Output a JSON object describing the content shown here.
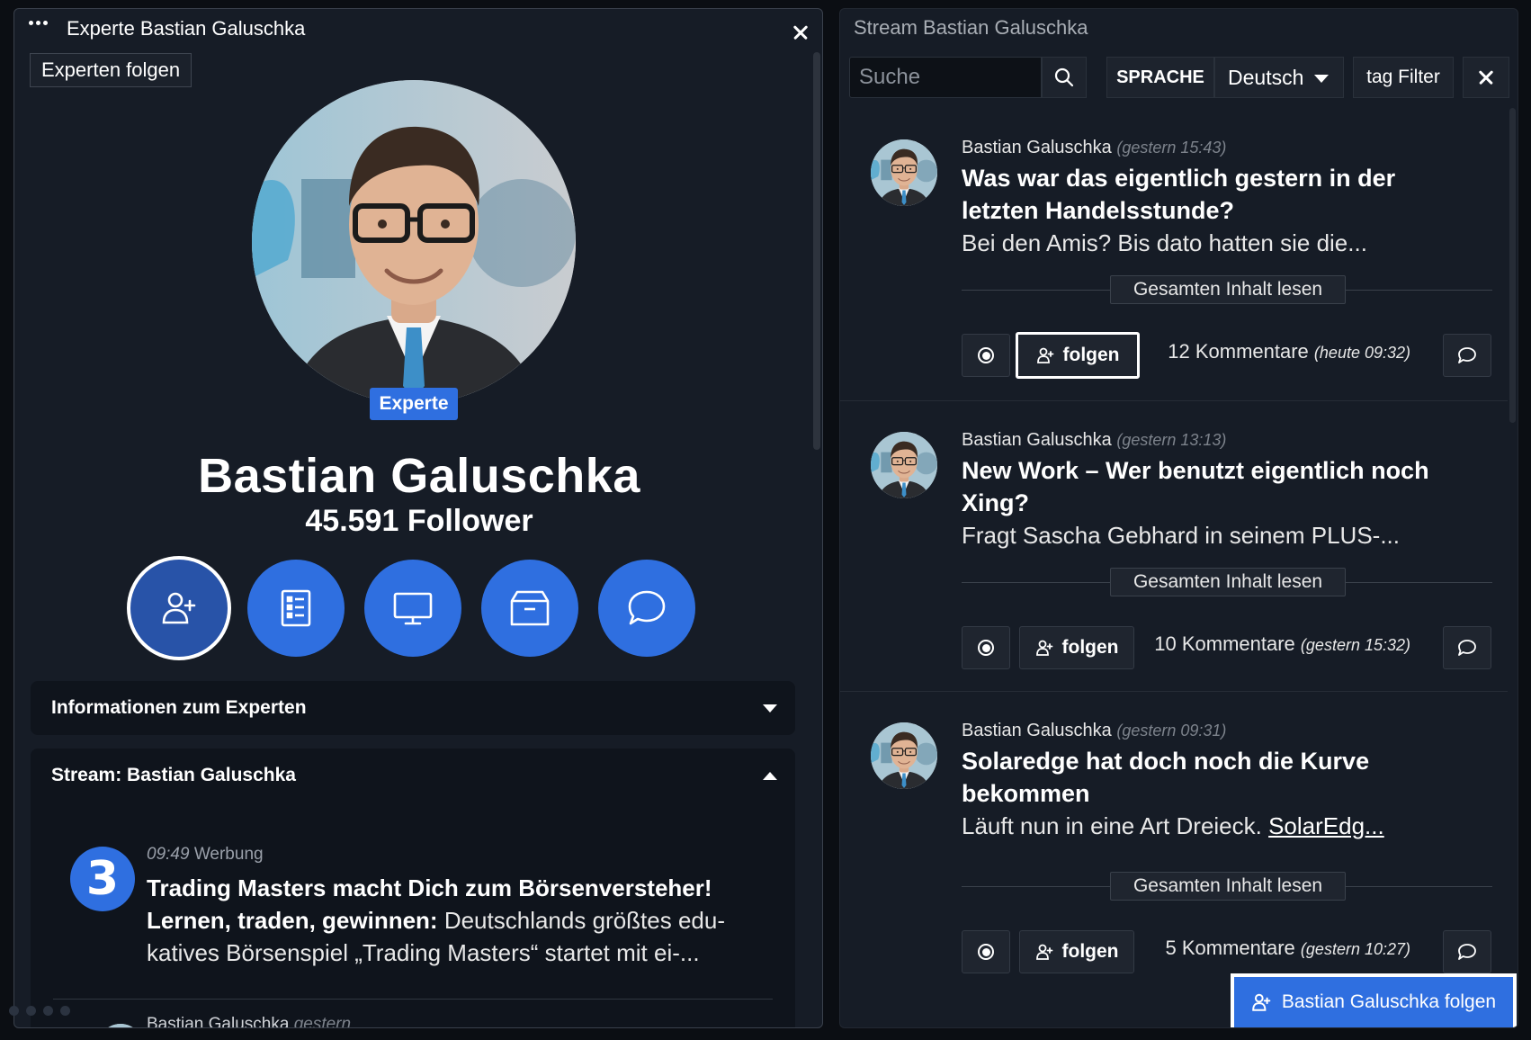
{
  "left_panel": {
    "header_title": "Experte Bastian Galuschka",
    "follow_expert_label": "Experten folgen",
    "badge": "Experte",
    "expert_name": "Bastian Galuschka",
    "follower_count": "45.591 Follower",
    "action_icons": [
      "follow-user-icon",
      "article-list-icon",
      "monitor-icon",
      "archive-box-icon",
      "chat-bubble-icon"
    ],
    "info_section_title": "Informationen zum Experten",
    "stream_section_title": "Stream: Bastian Galuschka",
    "ad": {
      "logo_glyph": "3",
      "time": "09:49",
      "tag": "Werbung",
      "title": "Trading Masters macht Dich zum Börsenversteher!",
      "body_strong": "Lernen, traden, gewinnen:",
      "body_text": " Deutschlands größtes edu-katives Börsenspiel „Trading Masters“ startet mit ei-..."
    },
    "next_item_author": "Bastian Galuschka",
    "next_item_time": "gestern"
  },
  "right_panel": {
    "title": "Stream Bastian Galuschka",
    "search_placeholder": "Suche",
    "language_label": "SPRACHE",
    "language_value": "Deutsch",
    "tag_filter_label": "tag Filter",
    "read_more_label": "Gesamten Inhalt lesen",
    "follow_label": "folgen",
    "posts": [
      {
        "author": "Bastian Galuschka",
        "time": "(gestern 15:43)",
        "title": "Was war das eigentlich gestern in der letzten Handelsstunde?",
        "excerpt": "Bei den Amis? Bis dato hatten sie die...",
        "excerpt_link": "",
        "comments": "12 Kommentare",
        "comments_time": "(heute 09:32)"
      },
      {
        "author": "Bastian Galuschka",
        "time": "(gestern 13:13)",
        "title": "New Work – Wer benutzt eigentlich noch Xing?",
        "excerpt": "Fragt Sascha Gebhard in seinem PLUS-...",
        "excerpt_link": "",
        "comments": "10 Kommentare",
        "comments_time": "(gestern 15:32)"
      },
      {
        "author": "Bastian Galuschka",
        "time": "(gestern 09:31)",
        "title": "Solaredge hat doch noch die Kurve bekommen",
        "excerpt": "Läuft nun in eine Art Dreieck. ",
        "excerpt_link": "SolarEdg...",
        "comments": "5 Kommentare",
        "comments_time": "(gestern 10:27)"
      }
    ],
    "cta_label": "Bastian Galuschka folgen"
  },
  "colors": {
    "accent": "#2f6fe0",
    "panel_bg": "#161c26",
    "page_bg": "#0b0e13"
  }
}
